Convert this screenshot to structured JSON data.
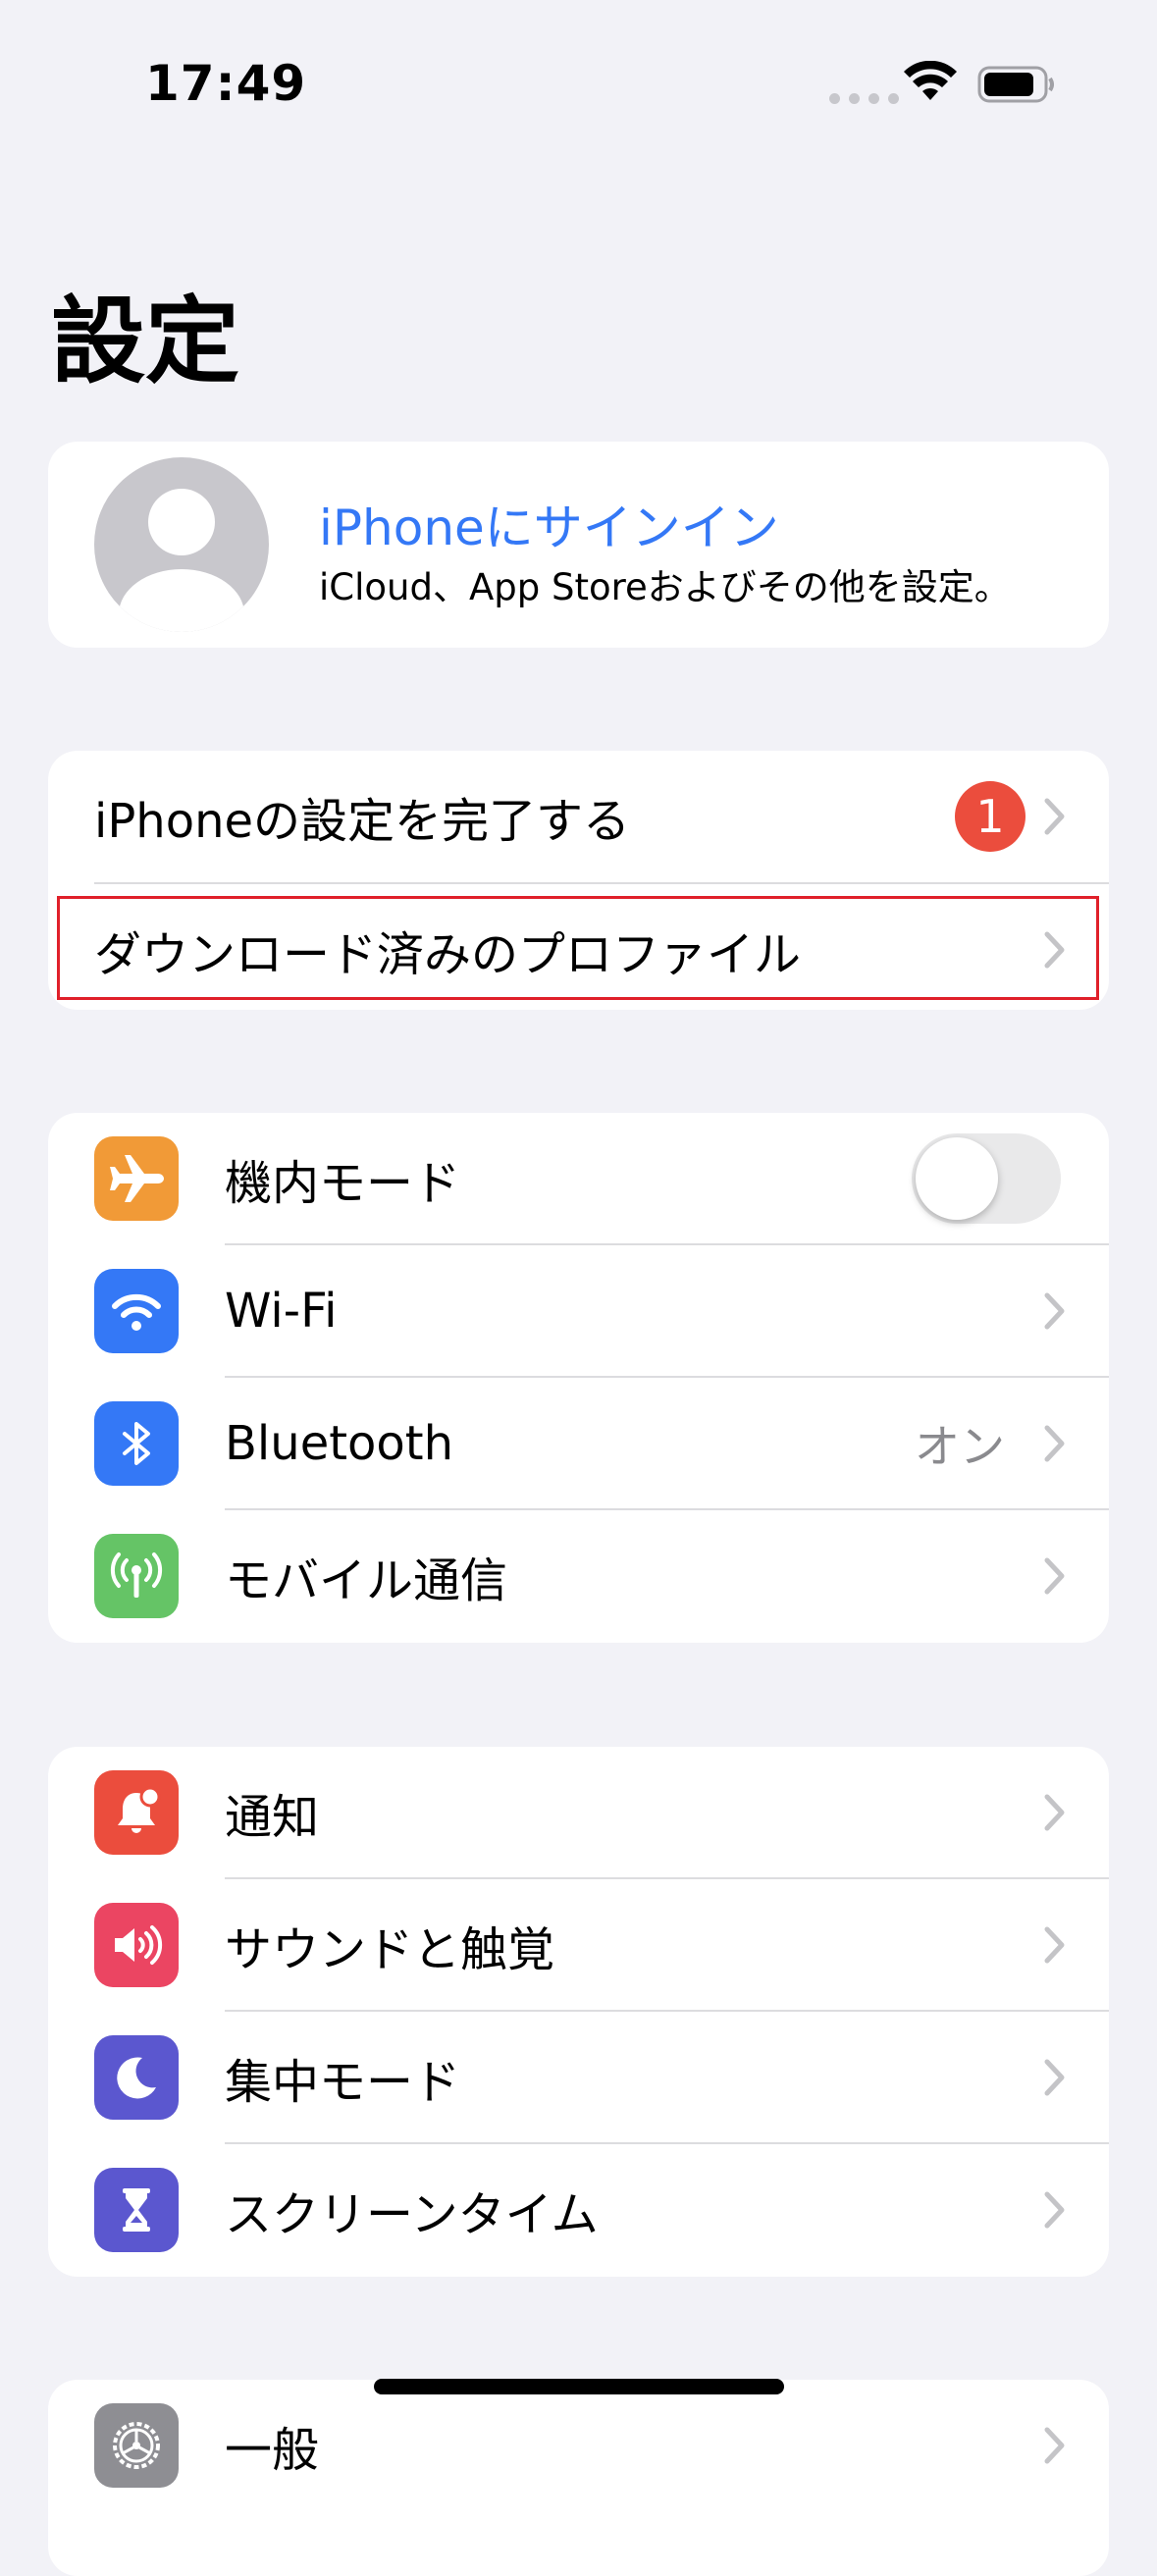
{
  "status_bar": {
    "time": "17:49"
  },
  "page": {
    "title": "設定"
  },
  "profile": {
    "title": "iPhoneにサインイン",
    "subtitle": "iCloud、App Storeおよびその他を設定。"
  },
  "setup": {
    "items": [
      {
        "label": "iPhoneの設定を完了する",
        "badge": "1"
      },
      {
        "label": "ダウンロード済みのプロファイル"
      }
    ]
  },
  "connectivity": {
    "items": [
      {
        "label": "機内モード",
        "icon": "airplane-icon",
        "color": "#f19a37",
        "toggle": false
      },
      {
        "label": "Wi-Fi",
        "icon": "wifi-icon",
        "color": "#3478f6"
      },
      {
        "label": "Bluetooth",
        "icon": "bluetooth-icon",
        "color": "#3478f6",
        "value": "オン"
      },
      {
        "label": "モバイル通信",
        "icon": "antenna-icon",
        "color": "#65c466"
      }
    ]
  },
  "notifications_group": {
    "items": [
      {
        "label": "通知",
        "icon": "bell-icon",
        "color": "#eb4d3d"
      },
      {
        "label": "サウンドと触覚",
        "icon": "speaker-icon",
        "color": "#eb4562"
      },
      {
        "label": "集中モード",
        "icon": "moon-icon",
        "color": "#5b57cf"
      },
      {
        "label": "スクリーンタイム",
        "icon": "hourglass-icon",
        "color": "#5b57cf"
      }
    ]
  },
  "general_group": {
    "items": [
      {
        "label": "一般",
        "icon": "gear-icon",
        "color": "#8e8e93"
      }
    ]
  }
}
